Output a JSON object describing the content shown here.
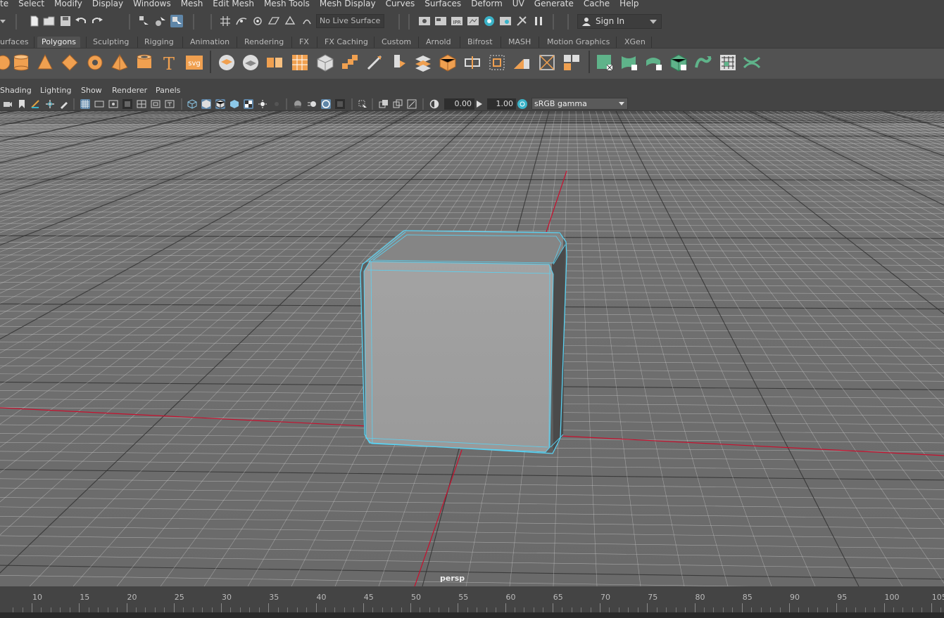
{
  "menu": [
    "te",
    "Select",
    "Modify",
    "Display",
    "Windows",
    "Mesh",
    "Edit Mesh",
    "Mesh Tools",
    "Mesh Display",
    "Curves",
    "Surfaces",
    "Deform",
    "UV",
    "Generate",
    "Cache",
    "Help"
  ],
  "status_line": {
    "live_surface": "No Live Surface",
    "sign_in": "Sign In",
    "ipr_label": "IPR"
  },
  "shelf_tabs": [
    "urfaces",
    "Polygons",
    "Sculpting",
    "Rigging",
    "Animation",
    "Rendering",
    "FX",
    "FX Caching",
    "Custom",
    "Arnold",
    "Bifrost",
    "MASH",
    "Motion Graphics",
    "XGen"
  ],
  "active_shelf_tab": "Polygons",
  "shelf_labels": {
    "text_tool": "T",
    "svg_tool": "svg"
  },
  "panel_menu": [
    "Shading",
    "Lighting",
    "Show",
    "Renderer",
    "Panels"
  ],
  "panel_toolbar": {
    "exposure": "0.00",
    "gamma": "1.00",
    "color_management": "sRGB gamma"
  },
  "viewport": {
    "camera": "persp"
  },
  "time_slider": {
    "ticks": [
      "10",
      "15",
      "20",
      "25",
      "30",
      "35",
      "40",
      "45",
      "50",
      "55",
      "60",
      "65",
      "70",
      "75",
      "80",
      "85",
      "90",
      "95",
      "100",
      "105"
    ]
  },
  "colors": {
    "ui_bg": "#444444",
    "shelf_bg": "#525252",
    "poly_orange": "#f0a050",
    "uv_green": "#5fb38a",
    "selection_cyan": "#5ad2f2",
    "axis_red": "#c8102e",
    "grid": "#d8d8d8"
  }
}
